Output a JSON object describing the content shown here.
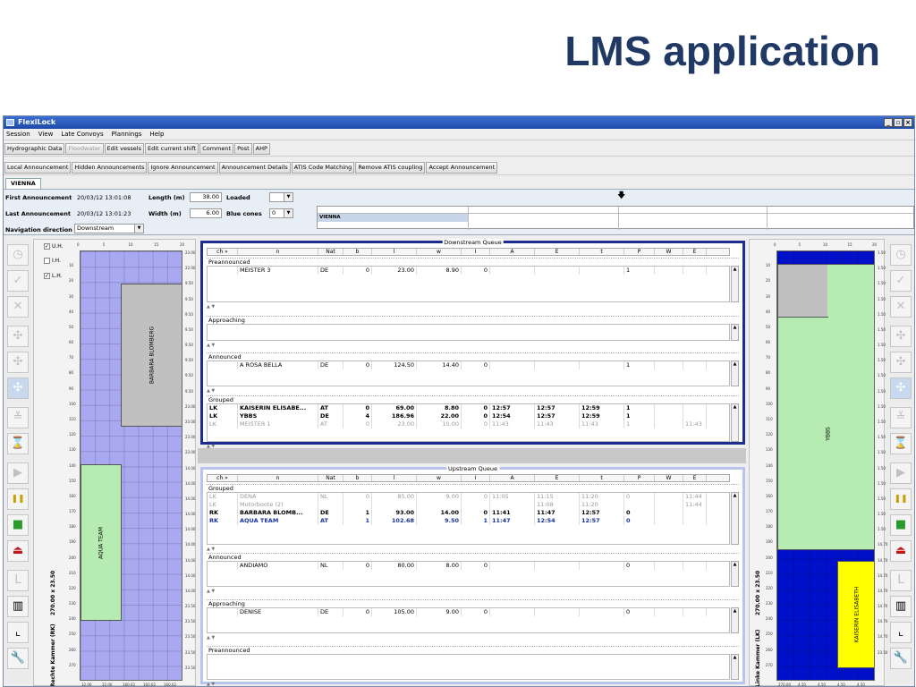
{
  "slide_title": "LMS application",
  "window": {
    "title": "FlexiLock",
    "min_glyph": "_",
    "max_glyph": "▫",
    "close_glyph": "×"
  },
  "menu": [
    "Session",
    "View",
    "Late Convoys",
    "Plannings",
    "Help"
  ],
  "toolbar1": [
    "Hydrographic Data",
    "Floodwater",
    "Edit vessels",
    "Edit current shift",
    "Comment",
    "Post",
    "AHP"
  ],
  "toolbar2": [
    "Local Announcement",
    "Hidden Announcements",
    "Ignore Announcement",
    "Announcement Details",
    "ATIS Code Matching",
    "Remove ATIS coupling",
    "Accept Announcement"
  ],
  "lock_tab": "VIENNA",
  "info": {
    "first_ann_label": "First Announcement",
    "first_ann_value": "20/03/12 13:01:08",
    "last_ann_label": "Last Announcement",
    "last_ann_value": "20/03/12 13:01:23",
    "nav_label": "Navigation direction",
    "nav_value": "Downstream",
    "length_label": "Length (m)",
    "length_value": "38.00",
    "width_label": "Width (m)",
    "width_value": "6.00",
    "loaded_label": "Loaded",
    "loaded_value": "",
    "cones_label": "Blue cones",
    "cones_value": "0",
    "timeline_label": "VIENNA",
    "timeline_marker": "🡇"
  },
  "left_chamber": {
    "checkboxes": [
      {
        "label": "U.H.",
        "checked": true
      },
      {
        "label": "I.H.",
        "checked": false
      },
      {
        "label": "L.H.",
        "checked": true
      }
    ],
    "ruler_top": [
      "0",
      "5",
      "10",
      "15",
      "20"
    ],
    "ruler_left": [
      "10",
      "20",
      "30",
      "40",
      "50",
      "60",
      "70",
      "80",
      "90",
      "100",
      "110",
      "120",
      "130",
      "140",
      "150",
      "160",
      "170",
      "180",
      "190",
      "200",
      "210",
      "220",
      "230",
      "240",
      "250",
      "260",
      "270"
    ],
    "ruler_right": [
      "23.00",
      "22.00",
      "9.50",
      "9.50",
      "9.50",
      "9.50",
      "9.50",
      "9.50",
      "9.50",
      "9.50",
      "23.00",
      "23.00",
      "23.00",
      "23.00",
      "14.00",
      "14.00",
      "14.00",
      "14.00",
      "14.00",
      "14.00",
      "14.00",
      "14.00",
      "14.00",
      "23.50",
      "23.50",
      "23.50",
      "23.50",
      "23.50"
    ],
    "ruler_bottom": [
      "32.00",
      "32.00",
      "160.02",
      "160.02",
      "160.02"
    ],
    "dims": "270.00 x 23.50",
    "name": "Rechte Kammer (RK)",
    "vessels": [
      {
        "name": "BARBARA BLOMBERG",
        "color": "#c0c0c0"
      },
      {
        "name": "AQUA TEAM",
        "color": "#b6ecb1"
      }
    ],
    "bg_color": "#a9a9f2"
  },
  "right_chamber": {
    "ruler_top": [
      "0",
      "5",
      "10",
      "15",
      "20"
    ],
    "ruler_left": [
      "10",
      "20",
      "30",
      "40",
      "50",
      "60",
      "70",
      "80",
      "90",
      "100",
      "110",
      "120",
      "130",
      "140",
      "150",
      "160",
      "170",
      "180",
      "190",
      "200",
      "210",
      "220",
      "230",
      "240",
      "250",
      "260",
      "270"
    ],
    "ruler_right": [
      "1.50",
      "1.50",
      "1.50",
      "1.50",
      "1.50",
      "1.50",
      "1.50",
      "1.50",
      "1.50",
      "1.50",
      "1.50",
      "1.50",
      "1.50",
      "1.50",
      "1.50",
      "1.50",
      "1.50",
      "1.50",
      "1.50",
      "14.70",
      "14.70",
      "14.70",
      "14.70",
      "14.70",
      "14.70",
      "14.70",
      "23.50"
    ],
    "ruler_bottom": [
      "270.00",
      "4.50",
      "4.50",
      "4.50",
      "4.50"
    ],
    "dims": "270.00 x 23.50",
    "name": "Linke Kammer (LK)",
    "vessels": [
      {
        "name": "YBBS",
        "color": "#b6ecb1"
      },
      {
        "name": "KAISERIN ELISABETH",
        "color": "#ffff00"
      }
    ],
    "bg_color": "#0010c8"
  },
  "columns": [
    "ch »",
    "n",
    "Nat",
    "b",
    "l",
    "w",
    "I",
    "A",
    "E",
    "t",
    "P",
    "W",
    "E"
  ],
  "downstream": {
    "title": "Downstream Queue",
    "groups": [
      {
        "label": "Preannounced",
        "rows": [
          {
            "style": "",
            "cells": [
              "",
              "MEISTER 3",
              "DE",
              "0",
              "23.00",
              "8.90",
              "0",
              "",
              "",
              "",
              "1",
              "",
              ""
            ]
          }
        ]
      },
      {
        "label": "Approaching",
        "rows": []
      },
      {
        "label": "Announced",
        "rows": [
          {
            "style": "",
            "cells": [
              "",
              "A ROSA BELLA",
              "DE",
              "0",
              "124.50",
              "14.40",
              "0",
              "",
              "",
              "",
              "1",
              "",
              ""
            ]
          }
        ]
      },
      {
        "label": "Grouped",
        "rows": [
          {
            "style": "bold",
            "cells": [
              "LK",
              "KAISERIN ELISABE...",
              "AT",
              "0",
              "69.00",
              "8.80",
              "0",
              "12:57",
              "12:57",
              "12:59",
              "1",
              "",
              ""
            ]
          },
          {
            "style": "bold",
            "cells": [
              "LK",
              "YBBS",
              "DE",
              "4",
              "186.96",
              "22.00",
              "0",
              "12:54",
              "12:57",
              "12:59",
              "1",
              "",
              ""
            ]
          },
          {
            "style": "grey",
            "cells": [
              "LK",
              "MEISTER 1",
              "AT",
              "0",
              "23.00",
              "10.00",
              "0",
              "11:43",
              "11:43",
              "11:43",
              "1",
              "",
              "11:43"
            ]
          }
        ]
      }
    ]
  },
  "upstream": {
    "title": "Upstream Queue",
    "groups": [
      {
        "label": "Grouped",
        "rows": [
          {
            "style": "grey",
            "cells": [
              "LK",
              "DENA",
              "NL",
              "0",
              "85.00",
              "9.00",
              "0",
              "11:05",
              "11:15",
              "11:20",
              "0",
              "",
              "11:44"
            ]
          },
          {
            "style": "grey",
            "cells": [
              "LK",
              "Motorboote (2)",
              "",
              "",
              "",
              "",
              "",
              "",
              "11:08",
              "11:20",
              "",
              "",
              "11:44"
            ]
          },
          {
            "style": "bold",
            "cells": [
              "RK",
              "BARBARA BLOMB...",
              "DE",
              "1",
              "93.00",
              "14.00",
              "0",
              "11:41",
              "11:47",
              "12:57",
              "0",
              "",
              ""
            ]
          },
          {
            "style": "blue",
            "cells": [
              "RK",
              "AQUA TEAM",
              "AT",
              "1",
              "102.68",
              "9.50",
              "1",
              "11:47",
              "12:54",
              "12:57",
              "0",
              "",
              ""
            ]
          }
        ]
      },
      {
        "label": "Announced",
        "rows": [
          {
            "style": "",
            "cells": [
              "",
              "ANDIAMO",
              "NL",
              "0",
              "80.00",
              "8.00",
              "0",
              "",
              "",
              "",
              "0",
              "",
              ""
            ]
          }
        ]
      },
      {
        "label": "Approaching",
        "rows": [
          {
            "style": "",
            "cells": [
              "",
              "DENISE",
              "DE",
              "0",
              "105.00",
              "9.00",
              "0",
              "",
              "",
              "",
              "0",
              "",
              ""
            ]
          }
        ]
      },
      {
        "label": "Preannounced",
        "rows": []
      }
    ]
  },
  "left_tools": [
    {
      "icon": "clock-icon",
      "glyph": "◷",
      "state": "dis"
    },
    {
      "icon": "check-icon",
      "glyph": "✓",
      "state": "dis"
    },
    {
      "icon": "cross-icon",
      "glyph": "✕",
      "state": "dis"
    },
    {
      "icon": "move-icon",
      "glyph": "✣",
      "state": "dis"
    },
    {
      "icon": "move-small-icon",
      "glyph": "✣",
      "state": "dis"
    },
    {
      "icon": "move-active-icon",
      "glyph": "✣",
      "state": "blue"
    },
    {
      "icon": "collapse-icon",
      "glyph": "≚",
      "state": "dis"
    },
    {
      "icon": "hourglass-icon",
      "glyph": "⌛",
      "state": ""
    },
    {
      "icon": "play-icon",
      "glyph": "▶",
      "state": "dis"
    },
    {
      "icon": "pause-icon",
      "glyph": "❚❚",
      "state": "pause"
    },
    {
      "icon": "green-square-icon",
      "glyph": "■",
      "state": "green"
    },
    {
      "icon": "eject-icon",
      "glyph": "⏏",
      "state": "red"
    },
    {
      "icon": "l-shape-icon",
      "glyph": "L",
      "state": "dis"
    },
    {
      "icon": "book-icon",
      "glyph": "▥",
      "state": ""
    },
    {
      "icon": "crop-icon",
      "glyph": "⌞",
      "state": ""
    },
    {
      "icon": "wrench-icon",
      "glyph": "🔧",
      "state": ""
    }
  ]
}
